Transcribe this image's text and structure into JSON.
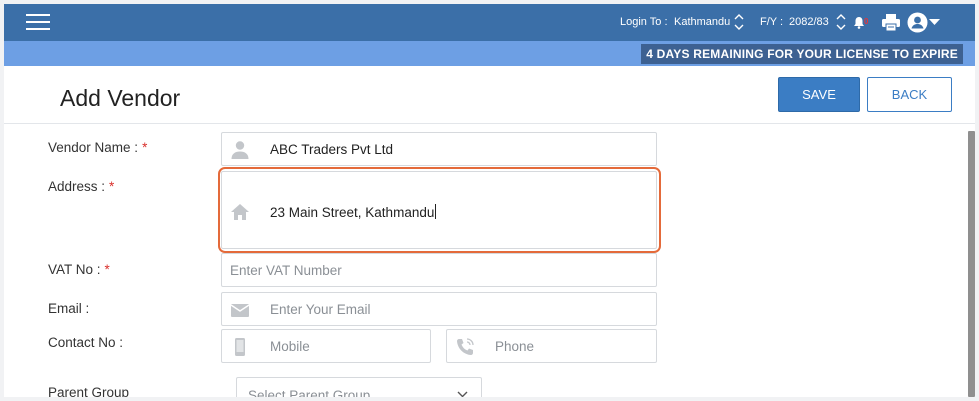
{
  "header": {
    "login_label": "Login To :",
    "login_value": "Kathmandu",
    "fy_label": "F/Y :",
    "fy_value": "2082/83",
    "notification_badge": "0"
  },
  "banner": {
    "license_text": "4 DAYS REMAINING FOR YOUR LICENSE TO EXPIRE"
  },
  "page": {
    "title": "Add Vendor"
  },
  "actions": {
    "save_label": "SAVE",
    "back_label": "BACK"
  },
  "form": {
    "vendor_name": {
      "label": "Vendor Name :",
      "required": "*",
      "value": "ABC Traders Pvt Ltd",
      "icon": "user-icon"
    },
    "address": {
      "label": "Address :",
      "required": "*",
      "value": "23 Main Street, Kathmandu",
      "icon": "home-icon"
    },
    "vat_no": {
      "label": "VAT No :",
      "required": "*",
      "placeholder": "Enter VAT Number"
    },
    "email": {
      "label": "Email :",
      "placeholder": "Enter Your Email",
      "icon": "envelope-icon"
    },
    "contact": {
      "label": "Contact No :",
      "mobile_placeholder": "Mobile",
      "phone_placeholder": "Phone",
      "mobile_icon": "mobile-icon",
      "phone_icon": "phone-icon"
    },
    "parent_group": {
      "label": "Parent Group",
      "placeholder": "Select Parent Group"
    }
  },
  "colors": {
    "topbar": "#3b6fa8",
    "banner": "#6d9fe4",
    "license_bg": "#3d6192",
    "primary": "#3b7dc4",
    "required": "#d9302c",
    "focus": "#e46a3a"
  }
}
